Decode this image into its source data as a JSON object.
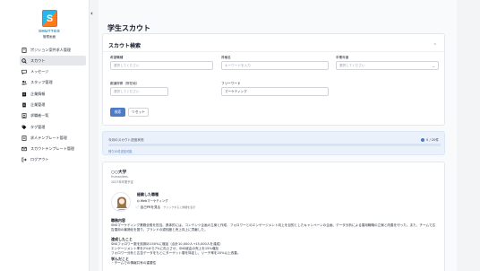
{
  "sidebar": {
    "logo_text": "SHUTTOS",
    "logo_sub": "管理画面",
    "items": [
      {
        "label": "ポジション案件求人管理",
        "icon": "building-icon"
      },
      {
        "label": "スカウト",
        "icon": "search-icon",
        "active": true
      },
      {
        "label": "メッセージ",
        "icon": "chat-icon"
      },
      {
        "label": "スタッフ管理",
        "icon": "users-icon"
      },
      {
        "label": "企業情報",
        "icon": "company-icon"
      },
      {
        "label": "企業管理",
        "icon": "document-icon"
      },
      {
        "label": "求職者一覧",
        "icon": "user-list-icon"
      },
      {
        "label": "タグ管理",
        "icon": "tag-icon"
      },
      {
        "label": "求人テンプレート管理",
        "icon": "template-icon"
      },
      {
        "label": "スカウトテンプレート管理",
        "icon": "mail-template-icon"
      },
      {
        "label": "ログアウト",
        "icon": "logout-icon"
      }
    ]
  },
  "page": {
    "title": "学生スカウト"
  },
  "search": {
    "title": "スカウト検索",
    "fields": {
      "desired_job": {
        "label": "希望職種",
        "placeholder": "選択してください"
      },
      "qualification": {
        "label": "資格名",
        "placeholder": "キーワードを入力"
      },
      "grad_year": {
        "label": "卒業年度",
        "placeholder": "選択してください"
      },
      "prefecture": {
        "label": "都道府県（所在地）",
        "placeholder": "選択してください"
      },
      "keyword": {
        "label": "フリーワード",
        "value": "マーケティング"
      }
    },
    "search_button": "検索",
    "reset_button": "リセット"
  },
  "status": {
    "label": "今月のスカウト送信状況",
    "count": "0 / 20件",
    "note": "残り20件送信可能",
    "fill_fraction": 0.0
  },
  "student": {
    "university": "○○大学",
    "faculty": "Humanities",
    "grad": "2027年卒業予定",
    "experience_heading": "経験した職種",
    "experience_tag": "Webマーケティング",
    "pr_button": "自己PRを見る",
    "pr_note": "クリックすると詳細を表示",
    "work_label": "職務内容",
    "work_text": "SNSマーケティング業務全般を担当。具体的には、コンテンツ企画の立案と作成、フォロワーとのエンゲージメント向上を目的としたキャンペーンの企画、データ分析による運用戦略の立案と改善を行った。また、チームで広告運用の最適化を図り、ブランドの認知度と売上向上に貢献した。",
    "achieve_label": "達成したこと",
    "achieve_lines": [
      "SNSフォロワー数を前期の150%に増加（合計10,000人→15,000人を達成）",
      "エンゲージメント率を2%から7%に向上させ、SNS経由の売上を15%増加",
      "フォロワー分析と広告データをもとにターゲット層を特定し、リーチ率を20%以上改善。"
    ],
    "learn_label": "学んだこと",
    "learn_lines": [
      "・チームでの情報共有の重要性"
    ]
  }
}
